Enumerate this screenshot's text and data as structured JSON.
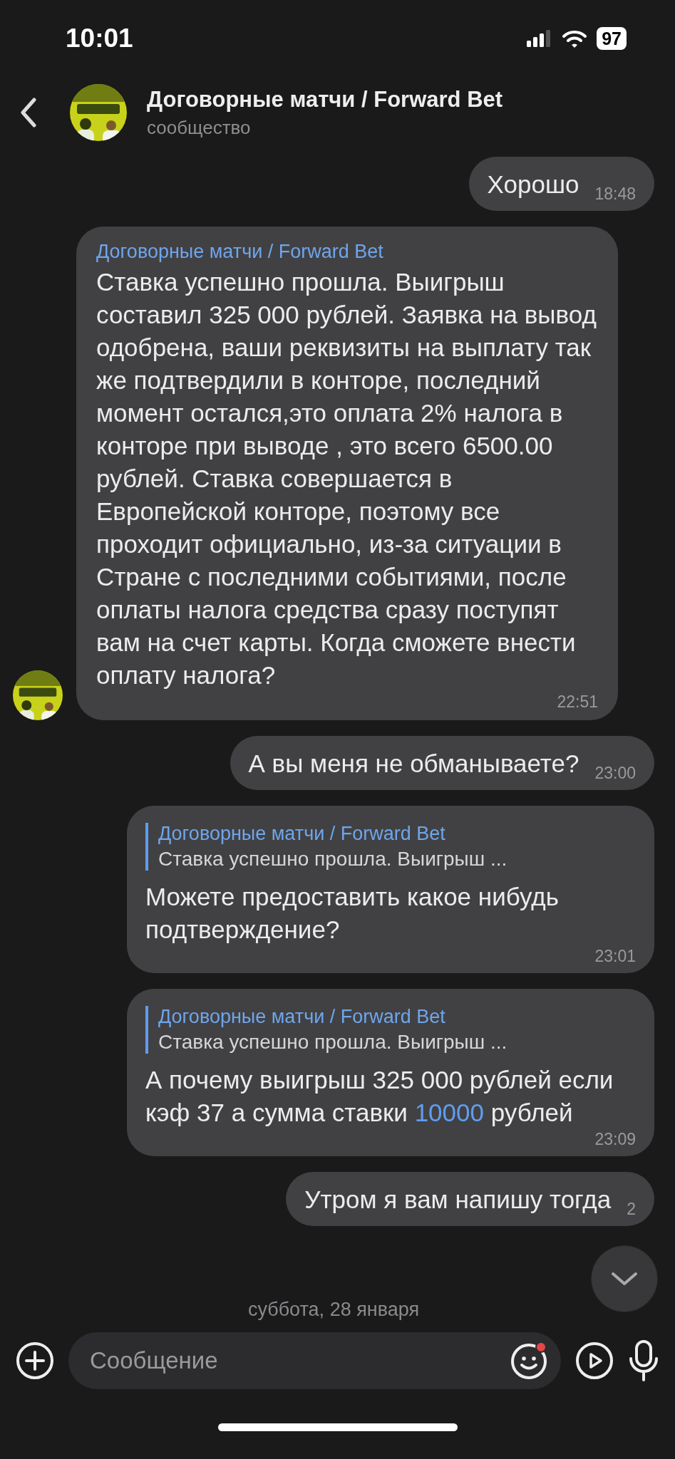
{
  "status_bar": {
    "time": "10:01",
    "battery": "97"
  },
  "header": {
    "title": "Договорные матчи / Forward Bet",
    "subtitle": "сообщество"
  },
  "messages": [
    {
      "kind": "outgoing",
      "text": "Хорошо",
      "time": "18:48"
    },
    {
      "kind": "incoming",
      "sender": "Договорные матчи / Forward Bet",
      "text": "Ставка успешно прошла. Выигрыш составил 325 000 рублей. Заявка на вывод одобрена, ваши реквизиты на выплату так же подтвердили в конторе, последний момент остался,это оплата 2% налога в конторе при выводе , это всего 6500.00 рублей. Ставка совершается в Европейской конторе, поэтому все проходит официально, из-за ситуации в Стране с последними событиями, после оплаты налога средства сразу поступят вам на счет карты. Когда сможете внести оплату налога?",
      "time": "22:51"
    },
    {
      "kind": "outgoing",
      "text": "А вы меня не обманываете?",
      "time": "23:00"
    },
    {
      "kind": "outgoing",
      "reply": {
        "sender": "Договорные матчи / Forward Bet",
        "text": "Ставка успешно прошла. Выигрыш ..."
      },
      "text": "Можете предоставить какое нибудь подтверждение?",
      "time": "23:01"
    },
    {
      "kind": "outgoing",
      "reply": {
        "sender": "Договорные матчи / Forward Bet",
        "text": "Ставка успешно прошла. Выигрыш ..."
      },
      "text": "А почему выигрыш 325 000 рублей если кэф 37 а сумма ставки",
      "link": "10000",
      "text_after": "рублей",
      "time": "23:09"
    },
    {
      "kind": "outgoing",
      "text": "Утром я вам напишу тогда",
      "time": "2"
    }
  ],
  "date_separator": "суббота, 28 января",
  "composer": {
    "placeholder": "Сообщение",
    "emoji_notification": true
  }
}
